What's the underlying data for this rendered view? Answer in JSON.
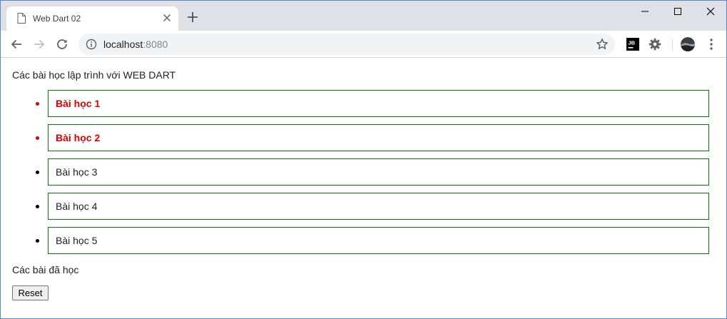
{
  "browser": {
    "tab_title": "Web Dart 02",
    "url_host": "localhost",
    "url_port": ":8080",
    "extension_jb_label": "JB"
  },
  "page": {
    "heading": "Các bài học lập trình với WEB DART",
    "lessons": [
      {
        "label": "Bài học 1",
        "done": true
      },
      {
        "label": "Bài học 2",
        "done": true
      },
      {
        "label": "Bài học 3",
        "done": false
      },
      {
        "label": "Bài học 4",
        "done": false
      },
      {
        "label": "Bài học 5",
        "done": false
      }
    ],
    "done_section_title": "Các bài đã học",
    "reset_label": "Reset"
  },
  "colors": {
    "lesson_border": "#0c7c0c",
    "done_text": "#e00000",
    "tab_strip": "#dee1e6",
    "omnibox": "#f1f3f4"
  },
  "icons": {
    "tab": "document-icon",
    "tab_close": "close-icon",
    "new_tab": "plus-icon",
    "back": "arrow-left-icon",
    "forward": "arrow-right-icon",
    "reload": "reload-icon",
    "site_info": "info-icon",
    "bookmark": "star-icon",
    "extension_1": "jetbrains-icon",
    "extension_2": "gear-icon",
    "profile": "avatar",
    "menu": "kebab-menu-icon"
  }
}
